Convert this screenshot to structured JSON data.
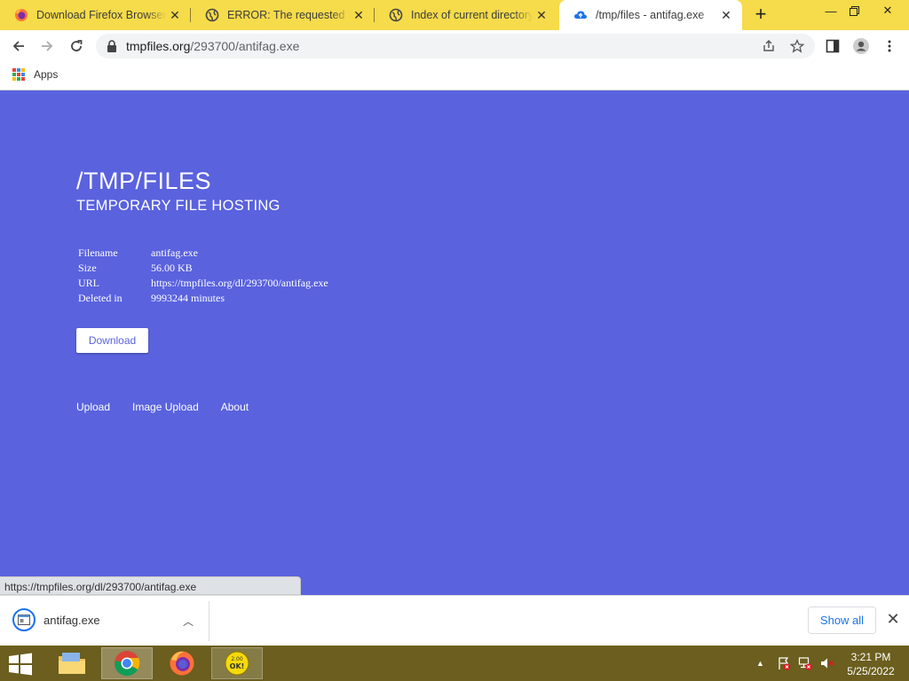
{
  "browser": {
    "tabs": [
      {
        "title": "Download Firefox Browser",
        "icon": "firefox-icon",
        "active": false
      },
      {
        "title": "ERROR: The requested URL",
        "icon": "globe-icon",
        "active": false
      },
      {
        "title": "Index of current directory...",
        "icon": "globe-icon",
        "active": false
      },
      {
        "title": "/tmp/files - antifag.exe",
        "icon": "cloud-upload-icon",
        "active": true
      }
    ],
    "new_tab": "+",
    "address": {
      "host": "tmpfiles.org",
      "path": "/293700/antifag.exe"
    },
    "bookmarks": {
      "apps_label": "Apps"
    }
  },
  "page": {
    "title": "/TMP/FILES",
    "subtitle": "TEMPORARY FILE HOSTING",
    "info": [
      {
        "key": "Filename",
        "value": "antifag.exe"
      },
      {
        "key": "Size",
        "value": "56.00 KB"
      },
      {
        "key": "URL",
        "value": "https://tmpfiles.org/dl/293700/antifag.exe"
      },
      {
        "key": "Deleted in",
        "value": "9993244 minutes"
      }
    ],
    "download_label": "Download",
    "footer_links": [
      "Upload",
      "Image Upload",
      "About"
    ],
    "background_color": "#5a62de"
  },
  "status_url": "https://tmpfiles.org/dl/293700/antifag.exe",
  "download_shelf": {
    "file": "antifag.exe",
    "show_all": "Show all"
  },
  "taskbar": {
    "time": "3:21 PM",
    "date": "5/25/2022",
    "color": "#6b5e1e"
  }
}
